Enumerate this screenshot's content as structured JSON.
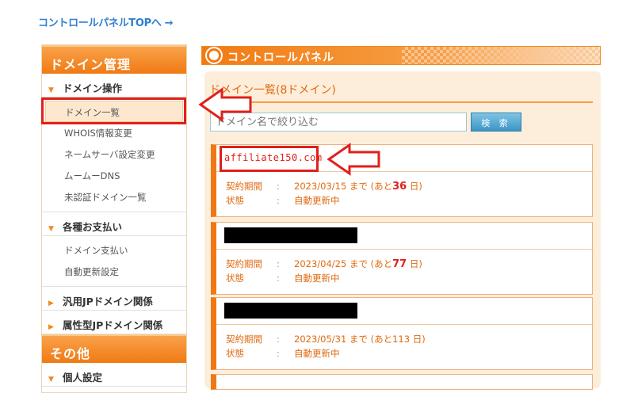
{
  "top_link": {
    "label": "コントロールパネルTOPへ",
    "arrow": "→"
  },
  "sidebar": {
    "header1": "ドメイン管理",
    "cat_domain_ops": "ドメイン操作",
    "domain_ops_items": [
      "ドメイン一覧",
      "WHOIS情報変更",
      "ネームサーバ設定変更",
      "ムームーDNS",
      "未認証ドメイン一覧"
    ],
    "cat_payments": "各種お支払い",
    "payment_items": [
      "ドメイン支払い",
      "自動更新設定"
    ],
    "cat_jp_general": "汎用JPドメイン関係",
    "cat_jp_attr": "属性型JPドメイン関係",
    "header2": "その他",
    "cat_personal": "個人設定"
  },
  "main": {
    "panel_title": "コントロールパネル",
    "list_title": "ドメイン一覧(8ドメイン)",
    "search": {
      "placeholder": "ドメイン名で絞り込む",
      "button": "検 索"
    },
    "labels": {
      "period": "契約期間",
      "status": "状態",
      "colon": ":",
      "until": "まで",
      "remaining_prefix": "(あと",
      "remaining_suffix": "日)"
    },
    "cards": [
      {
        "domain": "affiliate150.com",
        "masked": false,
        "date": "2023/03/15",
        "days": "36",
        "status": "自動更新中"
      },
      {
        "domain": "",
        "masked": true,
        "date": "2023/04/25",
        "days": "77",
        "status": "自動更新中"
      },
      {
        "domain": "",
        "masked": true,
        "date": "2023/05/31",
        "days": "113",
        "status": "自動更新中"
      }
    ]
  },
  "colors": {
    "accent": "#f07814",
    "annotation_red": "#e0201c",
    "link_blue": "#2f7fd0"
  }
}
